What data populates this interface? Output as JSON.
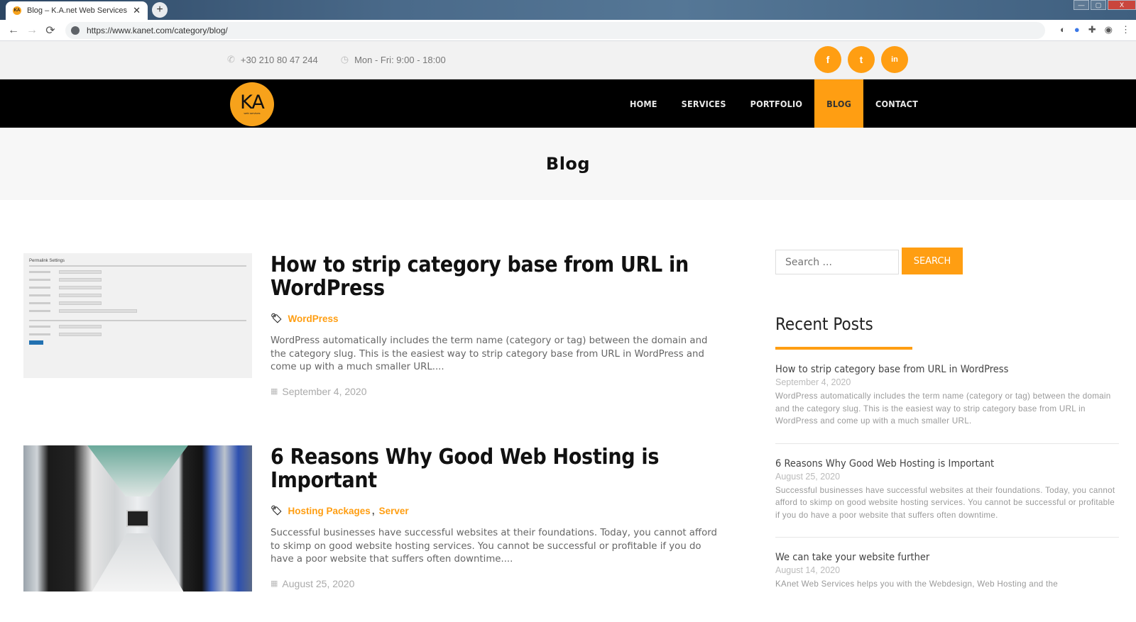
{
  "browser": {
    "tab_title": "Blog – K.A.net Web Services",
    "tab_favicon_text": "KA",
    "tab_close": "✕",
    "new_tab": "+",
    "url": "https://www.kanet.com/category/blog/",
    "back": "←",
    "forward": "→",
    "reload": "⟳",
    "window_controls": {
      "minimize": "—",
      "maximize": "▢",
      "close": "X"
    }
  },
  "topbar": {
    "phone": "+30 210 80 47 244",
    "hours": "Mon - Fri: 9:00 - 18:00",
    "socials": [
      {
        "name": "facebook",
        "glyph": "f"
      },
      {
        "name": "twitter",
        "glyph": "t"
      },
      {
        "name": "linkedin",
        "glyph": "in"
      }
    ]
  },
  "nav": {
    "logo_text": "KA",
    "logo_sub": "web services",
    "items": [
      {
        "label": "HOME",
        "active": false
      },
      {
        "label": "SERVICES",
        "active": false
      },
      {
        "label": "PORTFOLIO",
        "active": false
      },
      {
        "label": "BLOG",
        "active": true
      },
      {
        "label": "CONTACT",
        "active": false
      }
    ]
  },
  "page": {
    "title": "Blog"
  },
  "posts": [
    {
      "title": "How to strip category base from URL in WordPress",
      "categories": [
        "WordPress"
      ],
      "excerpt": "WordPress automatically includes the term name (category or tag) between the domain and the category slug. This is the easiest way to strip category base from URL in WordPress and come up with a much smaller URL....",
      "date": "September 4, 2020",
      "thumb_caption": "Permalink Settings"
    },
    {
      "title": "6 Reasons Why Good Web Hosting is Important",
      "categories": [
        "Hosting Packages",
        "Server"
      ],
      "excerpt": "Successful businesses have successful websites at their foundations. Today, you cannot afford to skimp on good website hosting services. You cannot be successful or profitable if you do have a poor website that suffers often downtime....",
      "date": "August 25, 2020"
    }
  ],
  "sidebar": {
    "search_placeholder": "Search ...",
    "search_button": "SEARCH",
    "recent_title": "Recent Posts",
    "recent_posts": [
      {
        "title": "How to strip category base from URL in WordPress",
        "date": "September 4, 2020",
        "excerpt": "WordPress automatically includes the term name (category or tag) between the domain and the category slug. This is the easiest way to strip category base from URL in WordPress and come up with a much smaller URL."
      },
      {
        "title": "6 Reasons Why Good Web Hosting is Important",
        "date": "August 25, 2020",
        "excerpt": "Successful businesses have successful websites at their foundations. Today, you cannot afford to skimp on good website hosting services. You cannot be successful or profitable if you do have a poor website that suffers often downtime."
      },
      {
        "title": "We can take your website further",
        "date": "August 14, 2020",
        "excerpt": "KAnet Web Services helps you with the Webdesign, Web Hosting and the"
      }
    ]
  },
  "colors": {
    "accent": "#ff9e12",
    "nav_bg": "#000000",
    "topbar_bg": "#f2f2f2"
  }
}
